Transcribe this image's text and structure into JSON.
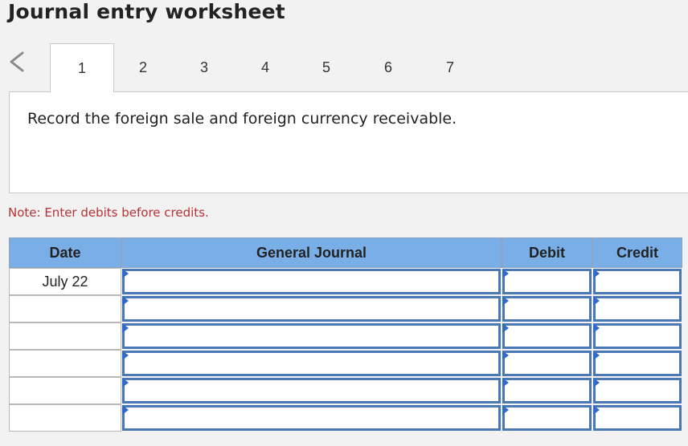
{
  "header": {
    "title": "Journal entry worksheet"
  },
  "tabs": [
    {
      "label": "1"
    },
    {
      "label": "2"
    },
    {
      "label": "3"
    },
    {
      "label": "4"
    },
    {
      "label": "5"
    },
    {
      "label": "6"
    },
    {
      "label": "7"
    }
  ],
  "active_tab": "1",
  "instruction": "Record the foreign sale and foreign currency receivable.",
  "note": "Note: Enter debits before credits.",
  "table": {
    "columns": [
      "Date",
      "General Journal",
      "Debit",
      "Credit"
    ],
    "rows": [
      {
        "date": "July 22",
        "account": "",
        "debit": "",
        "credit": ""
      },
      {
        "date": "",
        "account": "",
        "debit": "",
        "credit": ""
      },
      {
        "date": "",
        "account": "",
        "debit": "",
        "credit": ""
      },
      {
        "date": "",
        "account": "",
        "debit": "",
        "credit": ""
      },
      {
        "date": "",
        "account": "",
        "debit": "",
        "credit": ""
      },
      {
        "date": "",
        "account": "",
        "debit": "",
        "credit": ""
      }
    ]
  },
  "colors": {
    "header_bg": "#7aaee6",
    "input_border": "#4a78b5",
    "note": "#b83232"
  }
}
